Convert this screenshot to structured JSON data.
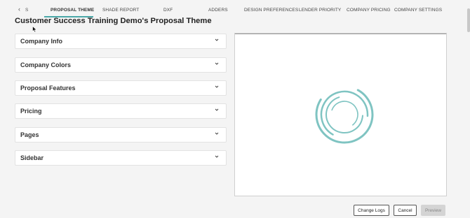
{
  "tabs": {
    "back_arrow": "‹",
    "partial_label": "S",
    "items": [
      {
        "label": "PROPOSAL THEME"
      },
      {
        "label": "SHADE REPORT"
      },
      {
        "label": "DXF"
      },
      {
        "label": "ADDERS"
      },
      {
        "label": "DESIGN PREFERENCES"
      },
      {
        "label": "LENDER PRIORITY"
      },
      {
        "label": "COMPANY PRICING"
      },
      {
        "label": "COMPANY SETTINGS"
      }
    ],
    "active_index": 0
  },
  "page_title": "Customer Success Training Demo's Proposal Theme",
  "sections": [
    {
      "label": "Company Info"
    },
    {
      "label": "Company Colors"
    },
    {
      "label": "Proposal Features"
    },
    {
      "label": "Pricing"
    },
    {
      "label": "Pages"
    },
    {
      "label": "Sidebar"
    }
  ],
  "buttons": {
    "change_logs": "Change Logs",
    "cancel": "Cancel",
    "preview": "Preview"
  },
  "colors": {
    "accent": "#4aa7a7",
    "spinner": "#7fc4c2"
  }
}
